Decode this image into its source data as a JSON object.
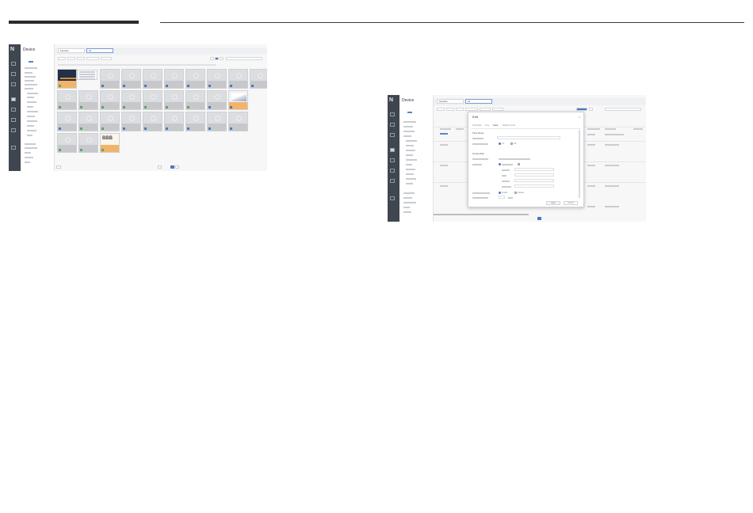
{
  "colors": {
    "accent": "#4a79c0",
    "sidebar": "#3f4650",
    "warning": "#f2b36a",
    "ok": "#5aa85e"
  },
  "left_panel": {
    "app_logo": "N",
    "title": "Device",
    "tabs": [
      {
        "label": "Favorites"
      },
      {
        "label": "All"
      }
    ],
    "tile_count": 50,
    "page_label": "1",
    "icons": [
      "dashboard-icon",
      "content-icon",
      "playlist-icon",
      "schedule-icon",
      "device-icon",
      "user-icon",
      "settings-icon",
      "help-icon"
    ]
  },
  "right_panel": {
    "app_logo": "N",
    "title": "Device",
    "tabs": [
      {
        "label": "Favorites"
      },
      {
        "label": "All"
      }
    ],
    "dialog": {
      "title": "Edit",
      "tabs": [
        {
          "label": "Information"
        },
        {
          "label": "Time"
        },
        {
          "label": "Setup"
        },
        {
          "label": "Display Control"
        }
      ],
      "section_time": "Time Zone",
      "section_connection": "Connection",
      "radio_on": "On",
      "radio_off": "Off",
      "radio_enable": "Enable",
      "radio_disable": "Disable",
      "btn_save": "Save",
      "btn_cancel": "Cancel"
    }
  }
}
